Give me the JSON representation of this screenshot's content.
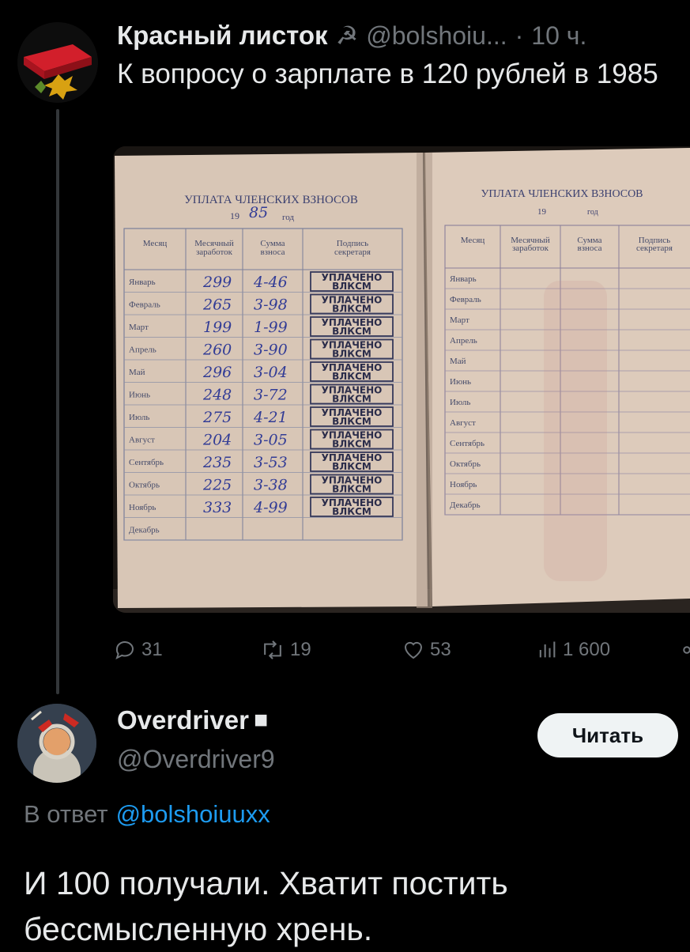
{
  "tweet": {
    "author_name": "Красный листок",
    "author_emoji": "☭",
    "handle": "@bolshoiu...",
    "separator": "·",
    "time": "10 ч.",
    "text": "К вопросу о зарплате в 120 рублей в 1985"
  },
  "photo": {
    "left_page": {
      "title": "УПЛАТА ЧЛЕНСКИХ ВЗНОСОВ",
      "year_prefix": "19",
      "year_handwritten": "85",
      "year_suffix": "год",
      "headers": [
        "Месяц",
        "Месячный заработок",
        "Сумма взноса",
        "Подпись секретаря"
      ],
      "rows": [
        {
          "month": "Январь",
          "salary": "299",
          "fee": "4-46",
          "stamp": "УПЛАЧЕНО ВЛКСМ"
        },
        {
          "month": "Февраль",
          "salary": "265",
          "fee": "3-98",
          "stamp": "УПЛАЧЕНО ВЛКСМ"
        },
        {
          "month": "Март",
          "salary": "199",
          "fee": "1-99",
          "stamp": "УПЛАЧЕНО ВЛКСМ"
        },
        {
          "month": "Апрель",
          "salary": "260",
          "fee": "3-90",
          "stamp": "УПЛАЧЕНО ВЛКСМ"
        },
        {
          "month": "Май",
          "salary": "296",
          "fee": "3-04",
          "stamp": "УПЛАЧЕНО ВЛКСМ"
        },
        {
          "month": "Июнь",
          "salary": "248",
          "fee": "3-72",
          "stamp": "УПЛАЧЕНО ВЛКСМ"
        },
        {
          "month": "Июль",
          "salary": "275",
          "fee": "4-21",
          "stamp": "УПЛАЧЕНО ВЛКСМ"
        },
        {
          "month": "Август",
          "salary": "204",
          "fee": "3-05",
          "stamp": "УПЛАЧЕНО ВЛКСМ"
        },
        {
          "month": "Сентябрь",
          "salary": "235",
          "fee": "3-53",
          "stamp": "УПЛАЧЕНО ВЛКСМ"
        },
        {
          "month": "Октябрь",
          "salary": "225",
          "fee": "3-38",
          "stamp": "УПЛАЧЕНО ВЛКСМ"
        },
        {
          "month": "Ноябрь",
          "salary": "333",
          "fee": "4-99",
          "stamp": "УПЛАЧЕНО ВЛКСМ"
        },
        {
          "month": "Декабрь",
          "salary": "",
          "fee": "",
          "stamp": ""
        }
      ]
    },
    "right_page": {
      "title": "УПЛАТА ЧЛЕНСКИХ ВЗНОСОВ",
      "year_prefix": "19",
      "year_suffix": "год",
      "headers": [
        "Месяц",
        "Месячный заработок",
        "Сумма взноса",
        "Подпись секретаря"
      ],
      "months": [
        "Январь",
        "Февраль",
        "Март",
        "Апрель",
        "Май",
        "Июнь",
        "Июль",
        "Август",
        "Сентябрь",
        "Октябрь",
        "Ноябрь",
        "Декабрь"
      ]
    }
  },
  "actions": {
    "replies": "31",
    "reposts": "19",
    "likes": "53",
    "views": "1 600"
  },
  "reply": {
    "author_name": "Overdriver",
    "badge": "■",
    "handle": "@Overdriver9",
    "follow_label": "Читать",
    "reply_prefix": "В ответ",
    "reply_to": "@bolshoiuuxx",
    "text": "И 100 получали. Хватит постить бессмысленную хрень."
  },
  "colors": {
    "background": "#000000",
    "text_primary": "#e7e9ea",
    "text_secondary": "#71767b",
    "link": "#1d9bf0",
    "button_bg": "#eff3f4",
    "thread_line": "#333639"
  }
}
